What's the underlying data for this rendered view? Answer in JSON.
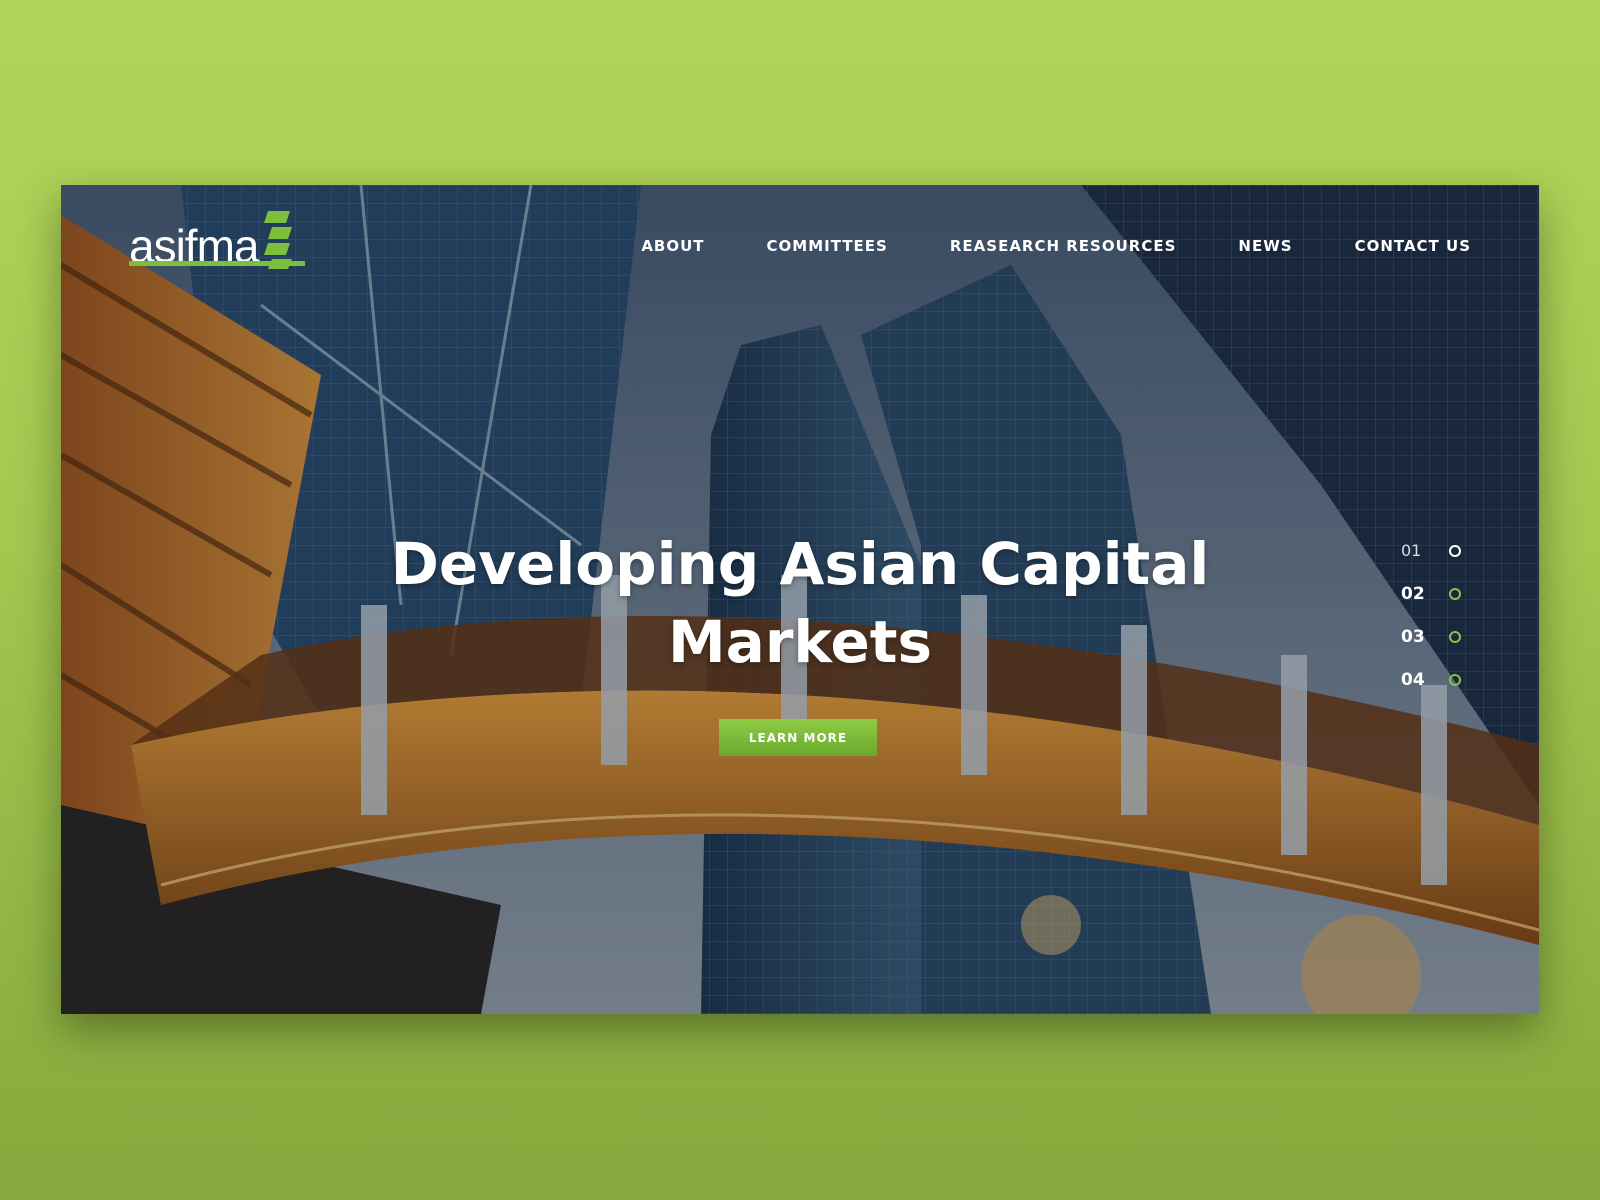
{
  "logo": {
    "text": "asifma"
  },
  "nav": {
    "items": [
      "ABOUT",
      "COMMITTEES",
      "REASEARCH RESOURCES",
      "NEWS",
      "CONTACT US"
    ]
  },
  "hero": {
    "title": "Developing Asian Capital Markets",
    "button_label": "LEARN MORE"
  },
  "slider": {
    "items": [
      "01",
      "02",
      "03",
      "04"
    ],
    "active_index": 0
  },
  "colors": {
    "brand_green": "#7cbf3a",
    "page_background": "#a2c84f",
    "bridge_orange": "#d9821e"
  }
}
